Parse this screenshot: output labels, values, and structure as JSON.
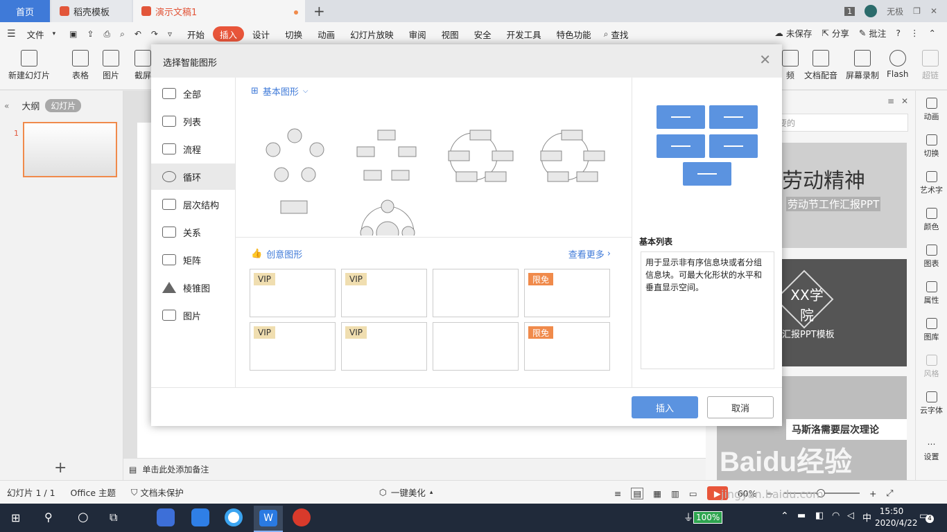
{
  "tabs": {
    "home": "首页",
    "template": "稻壳模板",
    "doc": "演示文稿1"
  },
  "window": {
    "badge": "1",
    "user": "无极"
  },
  "menu": {
    "file": "文件",
    "items": [
      "开始",
      "插入",
      "设计",
      "切换",
      "动画",
      "幻灯片放映",
      "审阅",
      "视图",
      "安全",
      "开发工具",
      "特色功能"
    ],
    "active": "插入",
    "search": "查找",
    "unsaved": "未保存",
    "share": "分享",
    "comment": "批注"
  },
  "ribbon": {
    "new_slide": "新建幻灯片",
    "table": "表格",
    "image": "图片",
    "screenshot": "截屏",
    "items_right": [
      "频",
      "文档配音",
      "屏幕录制",
      "Flash",
      "超链"
    ]
  },
  "left_panel": {
    "outline": "大纲",
    "slides": "幻灯片",
    "slide_num": "1"
  },
  "notes": {
    "placeholder": "单击此处添加备注"
  },
  "right_panel": {
    "search_placeholder": "要的",
    "cards": [
      {
        "title_big": "劳动精神",
        "subtitle": "劳动节工作汇报PPT"
      },
      {
        "title_big": "XX学院",
        "subtitle": "毕业汇报PPT模板"
      },
      {
        "title_big": "马斯洛需要层次理论",
        "subtitle": ""
      }
    ]
  },
  "sidebar": [
    "动画",
    "切换",
    "艺术字",
    "颜色",
    "图表",
    "属性",
    "图库",
    "风格",
    "云字体",
    "设置"
  ],
  "statusbar": {
    "slide_info": "幻灯片 1 / 1",
    "theme": "Office 主题",
    "protect": "文档未保护",
    "beautify": "一键美化",
    "zoom": "60%"
  },
  "taskbar": {
    "battery": "100%",
    "time": "15:50",
    "date": "2020/4/22",
    "notif": "4"
  },
  "dialog": {
    "title": "选择智能图形",
    "categories": [
      "全部",
      "列表",
      "流程",
      "循环",
      "层次结构",
      "关系",
      "矩阵",
      "棱锥图",
      "图片"
    ],
    "active_category": "循环",
    "section_basic": "基本图形",
    "section_creative": "创意图形",
    "see_more": "查看更多",
    "badges": [
      "VIP",
      "VIP",
      "",
      "限免",
      "VIP",
      "VIP",
      "",
      "限免"
    ],
    "preview_title": "基本列表",
    "preview_desc": "用于显示非有序信息块或者分组信息块。可最大化形状的水平和垂直显示空间。",
    "insert": "插入",
    "cancel": "取消"
  },
  "watermark": {
    "brand": "Baidu经验",
    "url": "jingyan.baidu.com"
  },
  "colors": {
    "accent": "#e8553a",
    "primary": "#3f7ad8",
    "preview_blue": "#5b93e0"
  }
}
